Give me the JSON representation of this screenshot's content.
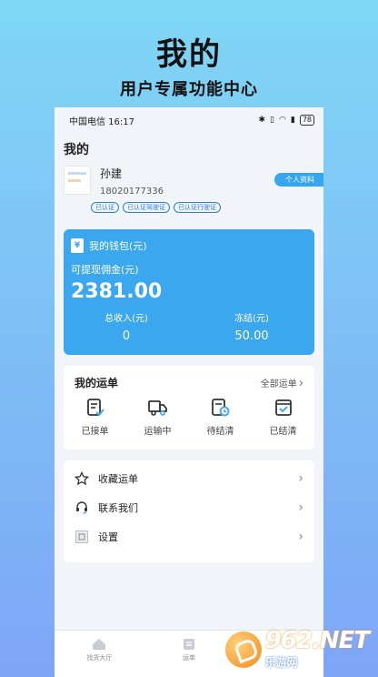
{
  "promo": {
    "title": "我的",
    "subtitle": "用户专属功能中心"
  },
  "status_bar": {
    "carrier_time": "中国电信 16:17",
    "battery": "78"
  },
  "page": {
    "title": "我的"
  },
  "profile": {
    "name": "孙建",
    "phone": "18020177336",
    "badges": [
      "已认证",
      "已认证驾驶证",
      "已认证行驶证"
    ],
    "details_button": "个人资料"
  },
  "wallet": {
    "title": "我的钱包(元)",
    "withdrawable_label": "可提现佣金(元)",
    "withdrawable_amount": "2381.00",
    "total_income_label": "总收入(元)",
    "total_income_value": "0",
    "frozen_label": "冻结(元)",
    "frozen_value": "50.00"
  },
  "orders": {
    "title": "我的运单",
    "all_label": "全部运单",
    "items": [
      "已接单",
      "运输中",
      "待结清",
      "已结清"
    ]
  },
  "menu": {
    "items": [
      "收藏运单",
      "联系我们",
      "设置"
    ]
  },
  "tabbar": {
    "items": [
      "找货大厅",
      "运单"
    ]
  },
  "watermark": {
    "number": "962",
    "domain": ".NET",
    "site": "乐游网"
  },
  "colors": {
    "accent": "#3aa7ef",
    "background_top": "#7fd7f5",
    "background_bottom": "#7ea6f7"
  }
}
